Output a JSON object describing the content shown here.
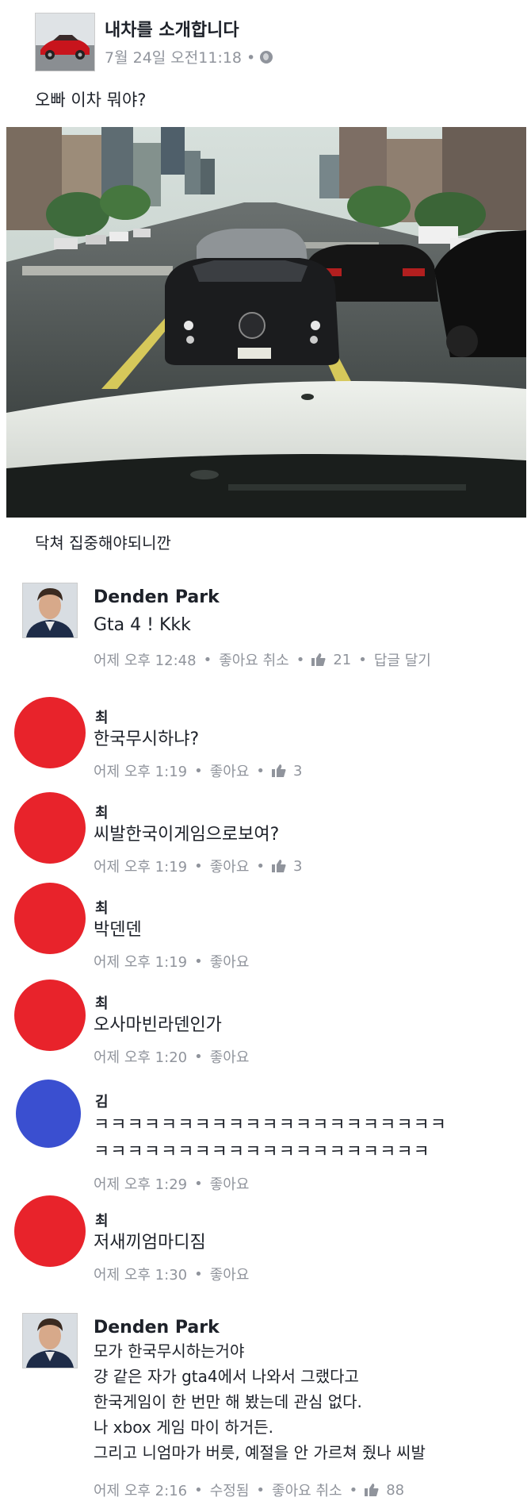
{
  "post": {
    "title": "내차를 소개합니다",
    "time": "7월 24일 오전11:18 •",
    "text": "오빠 이차 뭐야?",
    "caption": "닥쳐 집중해야되니깐"
  },
  "comments": [
    {
      "name": "Denden Park",
      "text": "Gta 4 ! Kkk",
      "time": "어제 오후 12:48",
      "like_label": "좋아요 취소",
      "like_count": "21",
      "reply_label": "답글 달기"
    },
    {
      "name": "최",
      "text": "한국무시하냐?",
      "time": "어제 오후 1:19",
      "like_label": "좋아요",
      "like_count": "3"
    },
    {
      "name": "최",
      "text": "씨발한국이게임으로보여?",
      "time": "어제 오후 1:19",
      "like_label": "좋아요",
      "like_count": "3"
    },
    {
      "name": "최",
      "text": "박덴덴",
      "time": "어제 오후 1:19",
      "like_label": "좋아요"
    },
    {
      "name": "최",
      "text": "오사마빈라덴인가",
      "time": "어제 오후 1:20",
      "like_label": "좋아요"
    },
    {
      "name": "김",
      "text_line1": "ㅋㅋㅋㅋㅋㅋㅋㅋㅋㅋㅋㅋㅋㅋㅋㅋㅋㅋㅋㅋㅋ",
      "text_line2": "ㅋㅋㅋㅋㅋㅋㅋㅋㅋㅋㅋㅋㅋㅋㅋㅋㅋㅋㅋㅋ",
      "time": "어제 오후 1:29",
      "like_label": "좋아요"
    },
    {
      "name": "최",
      "text": "저새끼엄마디짐",
      "time": "어제 오후 1:30",
      "like_label": "좋아요"
    },
    {
      "name": "Denden Park",
      "lines": [
        "모가 한국무시하는거야",
        "걍 같은 자가 gta4에서 나와서 그랬다고",
        "한국게임이 한 번만 해 봤는데 관심 없다.",
        "나 xbox 게임 마이 하거든.",
        "그리고 니엄마가 버릇, 예절을 안 가르쳐 줬나 씨발"
      ],
      "time": "어제 오후 2:16",
      "edited_label": "수정됨",
      "like_label": "좋아요 취소",
      "like_count": "88"
    }
  ],
  "colors": {
    "red_avatar": "#e8232b",
    "blue_avatar": "#3a4fd0",
    "meta_gray": "#90949c"
  },
  "icons": [
    "globe-icon",
    "thumbs-up-icon"
  ]
}
